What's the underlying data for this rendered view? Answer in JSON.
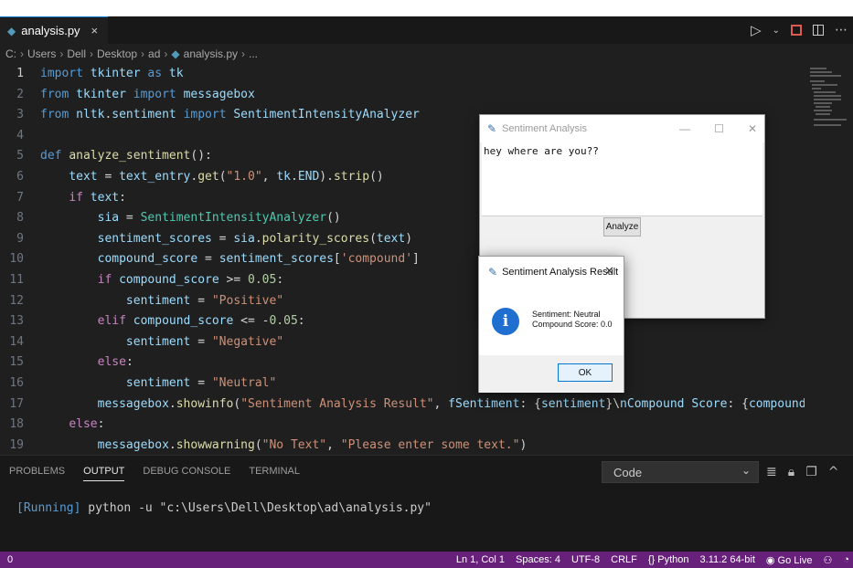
{
  "tab": {
    "filename": "analysis.py",
    "close": "×"
  },
  "breadcrumb": [
    "C:",
    "Users",
    "Dell",
    "Desktop",
    "ad",
    "analysis.py",
    "..."
  ],
  "editor": {
    "lines": [
      {
        "n": "1",
        "code": "import tkinter as tk"
      },
      {
        "n": "2",
        "code": "from tkinter import messagebox"
      },
      {
        "n": "3",
        "code": "from nltk.sentiment import SentimentIntensityAnalyzer"
      },
      {
        "n": "4",
        "code": ""
      },
      {
        "n": "5",
        "code": "def analyze_sentiment():"
      },
      {
        "n": "6",
        "code": "    text = text_entry.get(\"1.0\", tk.END).strip()"
      },
      {
        "n": "7",
        "code": "    if text:"
      },
      {
        "n": "8",
        "code": "        sia = SentimentIntensityAnalyzer()"
      },
      {
        "n": "9",
        "code": "        sentiment_scores = sia.polarity_scores(text)"
      },
      {
        "n": "10",
        "code": "        compound_score = sentiment_scores['compound']"
      },
      {
        "n": "11",
        "code": "        if compound_score >= 0.05:"
      },
      {
        "n": "12",
        "code": "            sentiment = \"Positive\""
      },
      {
        "n": "13",
        "code": "        elif compound_score <= -0.05:"
      },
      {
        "n": "14",
        "code": "            sentiment = \"Negative\""
      },
      {
        "n": "15",
        "code": "        else:"
      },
      {
        "n": "16",
        "code": "            sentiment = \"Neutral\""
      },
      {
        "n": "17",
        "code": "        messagebox.showinfo(\"Sentiment Analysis Result\", f\"Sentiment: {sentiment}\\nCompound Score: {compound_scor"
      },
      {
        "n": "18",
        "code": "    else:"
      },
      {
        "n": "19",
        "code": "        messagebox.showwarning(\"No Text\", \"Please enter some text.\")"
      }
    ]
  },
  "panel": {
    "tabs": [
      "PROBLEMS",
      "OUTPUT",
      "DEBUG CONSOLE",
      "TERMINAL"
    ],
    "active_tab": "OUTPUT",
    "channel": "Code",
    "output_prefix": "[Running]",
    "output_command": " python -u \"c:\\Users\\Dell\\Desktop\\ad\\analysis.py\""
  },
  "statusbar": {
    "left": "0",
    "position": "Ln 1, Col 1",
    "spaces": "Spaces: 4",
    "encoding": "UTF-8",
    "eol": "CRLF",
    "language": "{} Python",
    "interpreter": "3.11.2 64-bit",
    "golive": "Go Live"
  },
  "tk_window": {
    "title": "Sentiment Analysis",
    "text_value": "hey where are you??",
    "button": "Analyze"
  },
  "messagebox": {
    "title": "Sentiment Analysis Result",
    "line1": "Sentiment: Neutral",
    "line2": "Compound Score: 0.0",
    "ok": "OK"
  },
  "colors": {
    "accent": "#0078d4",
    "statusbar": "#68217a",
    "editor_bg": "#1f1f1f",
    "info_icon": "#1e6fd0"
  }
}
